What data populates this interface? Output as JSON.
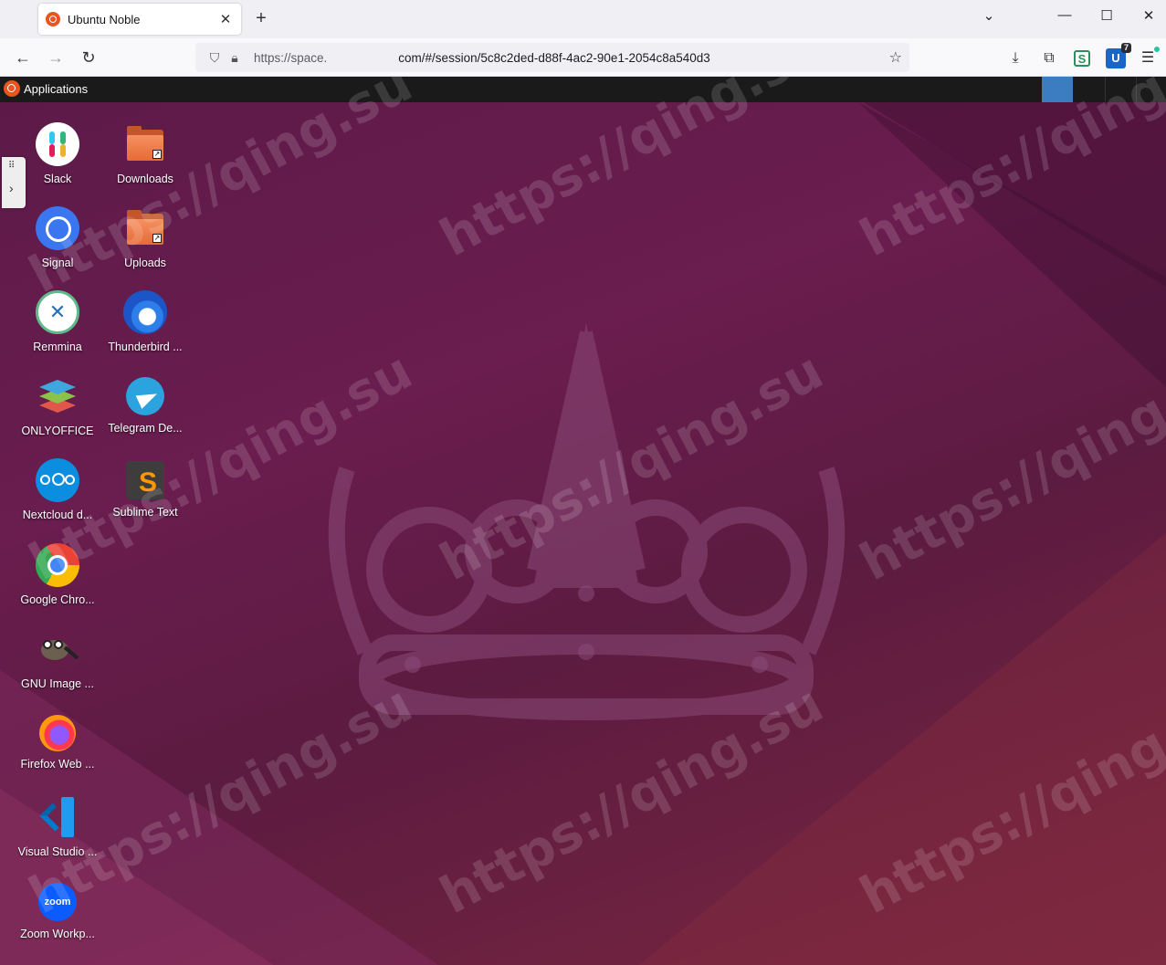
{
  "browser": {
    "tab_title": "Ubuntu Noble",
    "tab_close": "✕",
    "new_tab": "+",
    "url_prefix": "https://space.",
    "url_rest": "com/#/session/5c8c2ded-d88f-4ac2-90e1-2054c8a540d3",
    "extension_badge": "7",
    "ext_s_label": "S",
    "ext_u_label": "U"
  },
  "desktop": {
    "panel_label": "Applications",
    "icons_col1": [
      {
        "label": "Slack",
        "icon": "slack-icon"
      },
      {
        "label": "Signal",
        "icon": "signal-icon"
      },
      {
        "label": "Remmina",
        "icon": "remmina-icon"
      },
      {
        "label": "ONLYOFFICE",
        "icon": "onlyoffice-icon"
      },
      {
        "label": "Nextcloud d...",
        "icon": "nextcloud-icon"
      },
      {
        "label": "Google Chro...",
        "icon": "chrome-icon"
      },
      {
        "label": "GNU Image ...",
        "icon": "gimp-icon"
      },
      {
        "label": "Firefox Web ...",
        "icon": "firefox-icon"
      },
      {
        "label": "Visual Studio ...",
        "icon": "vscode-icon"
      },
      {
        "label": "Zoom Workp...",
        "icon": "zoom-icon"
      }
    ],
    "icons_col2": [
      {
        "label": "Downloads",
        "icon": "folder-icon"
      },
      {
        "label": "Uploads",
        "icon": "folder-icon"
      },
      {
        "label": "Thunderbird ...",
        "icon": "thunderbird-icon"
      },
      {
        "label": "Telegram De...",
        "icon": "telegram-icon"
      },
      {
        "label": "Sublime Text",
        "icon": "sublime-icon"
      }
    ]
  },
  "watermark": "https://qing.su",
  "colors": {
    "ubuntu_orange": "#e95420",
    "desktop_bg": "#5c1a48"
  }
}
